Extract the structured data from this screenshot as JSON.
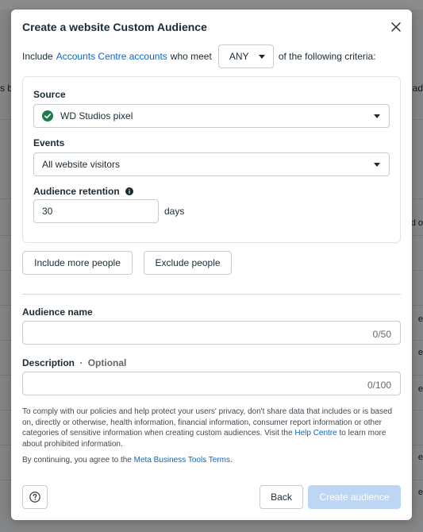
{
  "background": {
    "left_snippet": "s b",
    "right_snippet": "ad",
    "right_row_snippets": [
      "d o",
      "e",
      "e",
      "e",
      "e",
      "e"
    ]
  },
  "modal": {
    "title": "Create a website Custom Audience",
    "criteria": {
      "prefix": "Include",
      "link": "Accounts Centre accounts",
      "middle": "who meet",
      "match_value": "ANY",
      "suffix": "of the following criteria:"
    },
    "source": {
      "label": "Source",
      "value": "WD Studios pixel"
    },
    "events": {
      "label": "Events",
      "value": "All website visitors"
    },
    "retention": {
      "label": "Audience retention",
      "value": "30",
      "unit": "days"
    },
    "include_more_label": "Include more people",
    "exclude_label": "Exclude people",
    "audience_name": {
      "label": "Audience name",
      "value": "",
      "counter": "0/50"
    },
    "description": {
      "label": "Description",
      "optional": "Optional",
      "separator": "·",
      "value": "",
      "counter": "0/100"
    },
    "disclaimer": {
      "text": "To comply with our policies and help protect your users' privacy, don't share data that includes or is based on, directly or otherwise, health information, financial information, consumer report information or other categories of sensitive information when creating custom audiences. Visit the",
      "link": "Help Centre",
      "after": "to learn more about prohibited information."
    },
    "terms": {
      "prefix": "By continuing, you agree to the",
      "link": "Meta Business Tools Terms",
      "suffix": "."
    },
    "back_label": "Back",
    "create_label": "Create audience"
  },
  "colors": {
    "link": "#0a66c2",
    "check_green": "#1f7a4d",
    "primary_disabled": "#bcd6f4"
  }
}
